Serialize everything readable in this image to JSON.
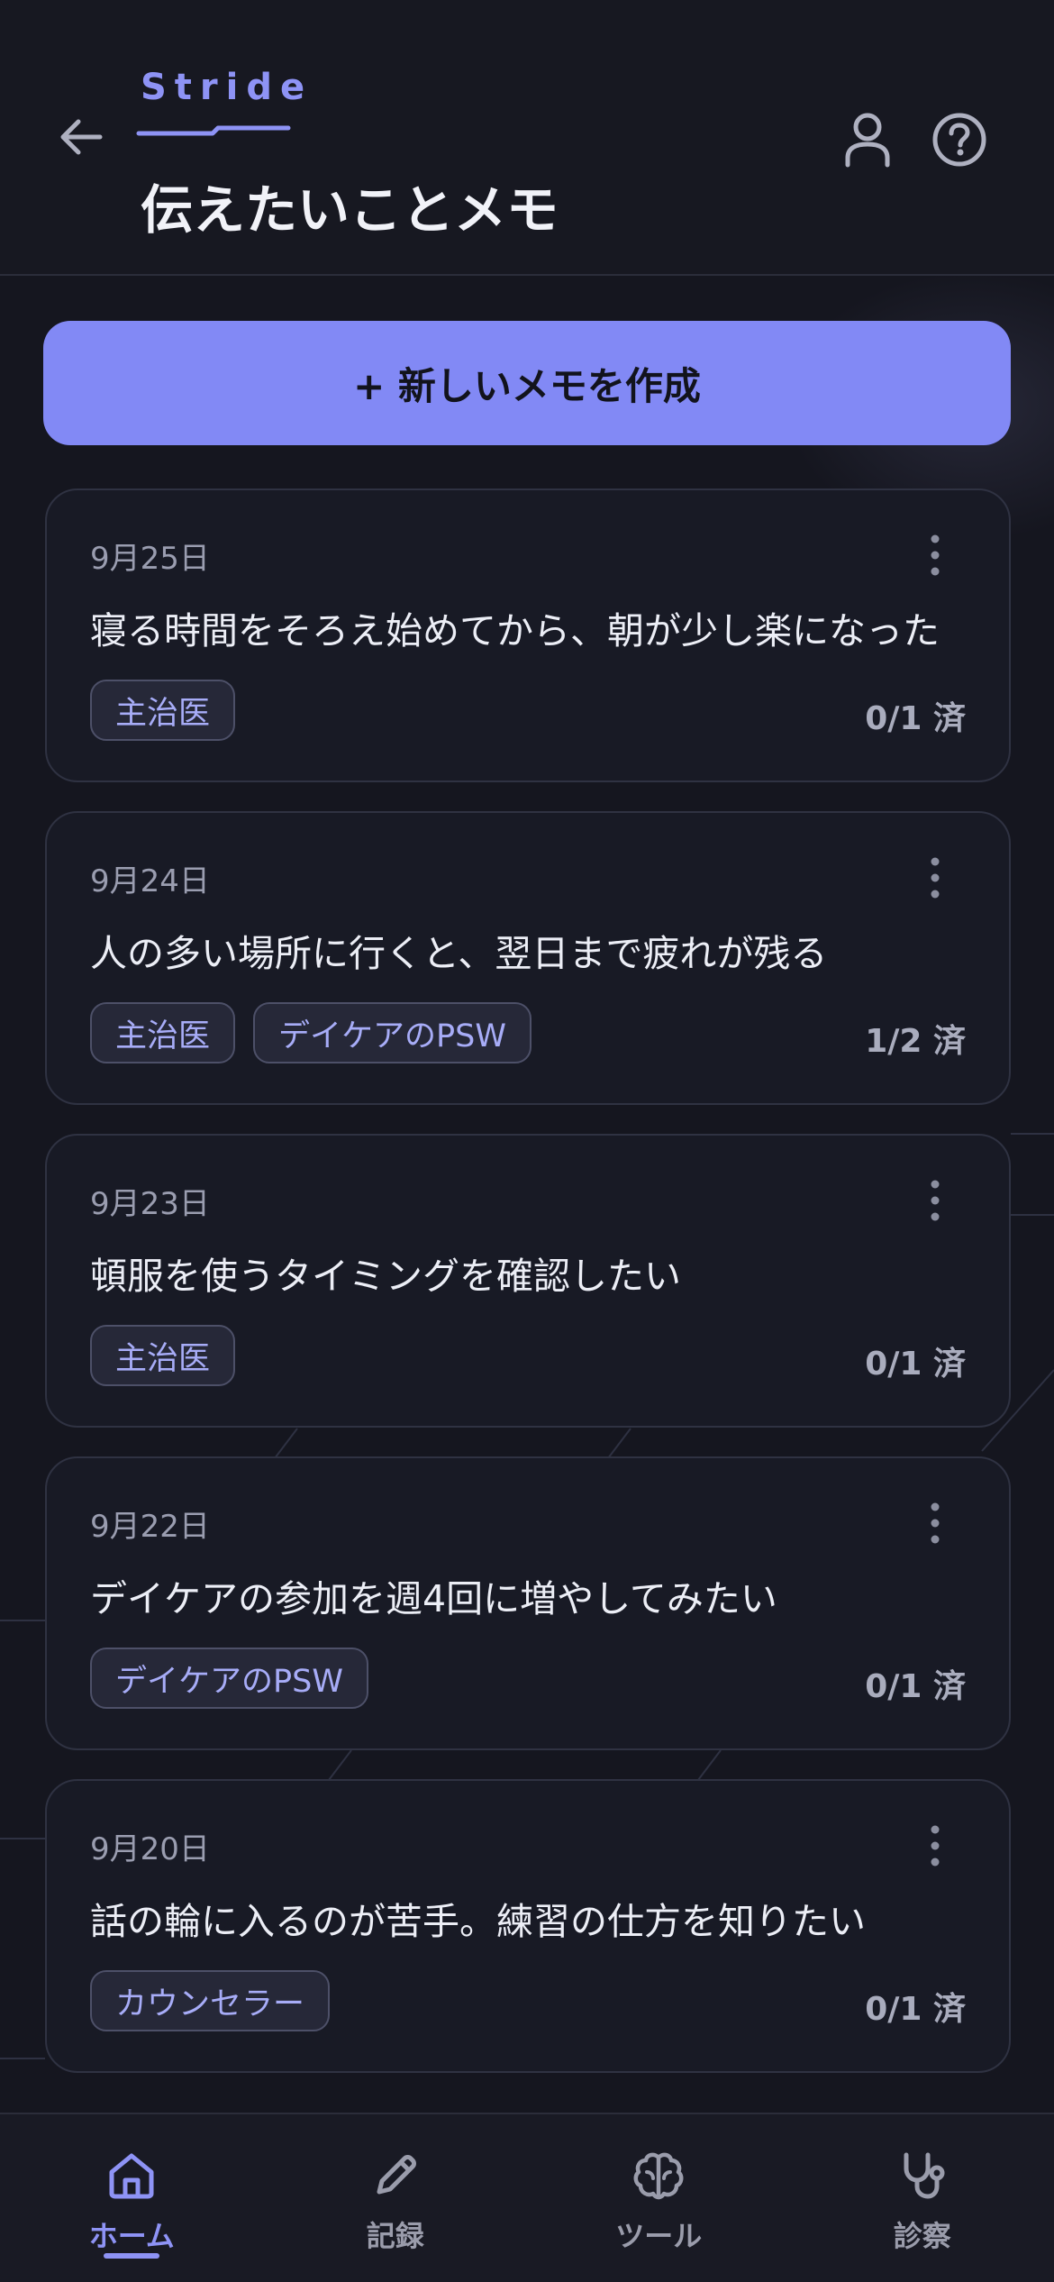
{
  "header": {
    "brand": "Stride",
    "title": "伝えたいことメモ"
  },
  "create_button": {
    "label": "+ 新しいメモを作成"
  },
  "memos": [
    {
      "date": "9月25日",
      "text": "寝る時間をそろえ始めてから、朝が少し楽になった",
      "tags": [
        "主治医"
      ],
      "status": "0/1 済"
    },
    {
      "date": "9月24日",
      "text": "人の多い場所に行くと、翌日まで疲れが残る",
      "tags": [
        "主治医",
        "デイケアのPSW"
      ],
      "status": "1/2 済"
    },
    {
      "date": "9月23日",
      "text": "頓服を使うタイミングを確認したい",
      "tags": [
        "主治医"
      ],
      "status": "0/1 済"
    },
    {
      "date": "9月22日",
      "text": "デイケアの参加を週4回に増やしてみたい",
      "tags": [
        "デイケアのPSW"
      ],
      "status": "0/1 済"
    },
    {
      "date": "9月20日",
      "text": "話の輪に入るのが苦手。練習の仕方を知りたい",
      "tags": [
        "カウンセラー"
      ],
      "status": "0/1 済"
    }
  ],
  "nav": {
    "home": "ホーム",
    "record": "記録",
    "tools": "ツール",
    "clinic": "診察"
  },
  "colors": {
    "accent": "#8e93f5",
    "button": "#8289f5",
    "background": "#15161f",
    "card": "#181a25"
  }
}
